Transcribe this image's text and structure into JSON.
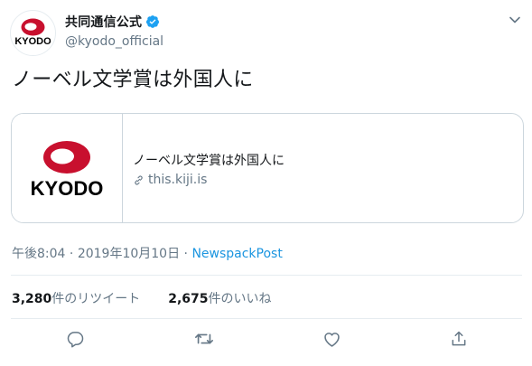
{
  "author": {
    "display_name": "共同通信公式",
    "handle": "@kyodo_official",
    "avatar_logo_text": "KYODO",
    "verified_icon": "verified-badge-icon",
    "menu_icon": "chevron-down-icon"
  },
  "tweet": {
    "text": "ノーベル文学賞は外国人に"
  },
  "card": {
    "thumb_logo_text": "KYODO",
    "title": "ノーベル文学賞は外国人に",
    "domain": "this.kiji.is",
    "domain_icon": "link-icon"
  },
  "meta": {
    "time": "午後8:04",
    "separator": "·",
    "date": "2019年10月10日",
    "source": "NewspackPost"
  },
  "stats": {
    "retweets_count": "3,280",
    "retweets_label": "件のリツイート",
    "likes_count": "2,675",
    "likes_label": "件のいいね"
  },
  "actions": [
    "reply-icon",
    "retweet-icon",
    "like-icon",
    "share-icon"
  ],
  "colors": {
    "text": "#14171a",
    "secondary": "#657786",
    "link": "#1b95e0",
    "border": "#ccd6dd",
    "kyodo_red": "#c8102e"
  }
}
